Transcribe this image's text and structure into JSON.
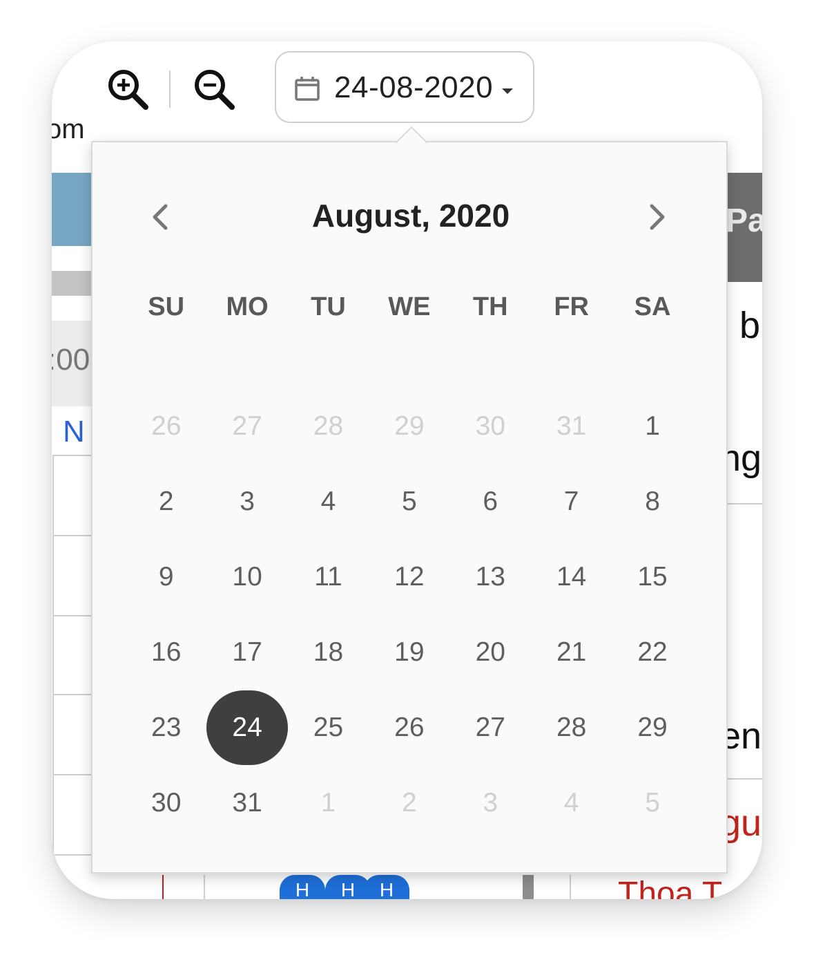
{
  "toolbar": {
    "zoom_label": "om",
    "zoom_in_icon": "zoom-in-icon",
    "zoom_out_icon": "zoom-out-icon",
    "date_value": "24-08-2020",
    "calendar_icon": "calendar-icon",
    "caret_icon": "caret-down-icon"
  },
  "background": {
    "time_fragment": ":00",
    "link_fragment": "N",
    "header_fragment": "Pa",
    "text_fragment_b": "b",
    "text_fragment_ng": "ng",
    "text_fragment_eng": "en",
    "red_fragment": "gu",
    "badge_label": "H",
    "bottom_red_text": "Thoa T"
  },
  "datepicker": {
    "title": "August, 2020",
    "prev_icon": "chevron-left-icon",
    "next_icon": "chevron-right-icon",
    "weekdays": [
      "SU",
      "MO",
      "TU",
      "WE",
      "TH",
      "FR",
      "SA"
    ],
    "weeks": [
      [
        {
          "d": "26",
          "m": true
        },
        {
          "d": "27",
          "m": true
        },
        {
          "d": "28",
          "m": true
        },
        {
          "d": "29",
          "m": true
        },
        {
          "d": "30",
          "m": true
        },
        {
          "d": "31",
          "m": true
        },
        {
          "d": "1"
        }
      ],
      [
        {
          "d": "2"
        },
        {
          "d": "3"
        },
        {
          "d": "4"
        },
        {
          "d": "5"
        },
        {
          "d": "6"
        },
        {
          "d": "7"
        },
        {
          "d": "8"
        }
      ],
      [
        {
          "d": "9"
        },
        {
          "d": "10"
        },
        {
          "d": "11"
        },
        {
          "d": "12"
        },
        {
          "d": "13"
        },
        {
          "d": "14"
        },
        {
          "d": "15"
        }
      ],
      [
        {
          "d": "16"
        },
        {
          "d": "17"
        },
        {
          "d": "18"
        },
        {
          "d": "19"
        },
        {
          "d": "20"
        },
        {
          "d": "21"
        },
        {
          "d": "22"
        }
      ],
      [
        {
          "d": "23"
        },
        {
          "d": "24",
          "s": true
        },
        {
          "d": "25"
        },
        {
          "d": "26"
        },
        {
          "d": "27"
        },
        {
          "d": "28"
        },
        {
          "d": "29"
        }
      ],
      [
        {
          "d": "30"
        },
        {
          "d": "31"
        },
        {
          "d": "1",
          "m": true
        },
        {
          "d": "2",
          "m": true
        },
        {
          "d": "3",
          "m": true
        },
        {
          "d": "4",
          "m": true
        },
        {
          "d": "5",
          "m": true
        }
      ]
    ],
    "selected_color": "#3f3f3f",
    "muted_color": "#d0d0d0"
  }
}
